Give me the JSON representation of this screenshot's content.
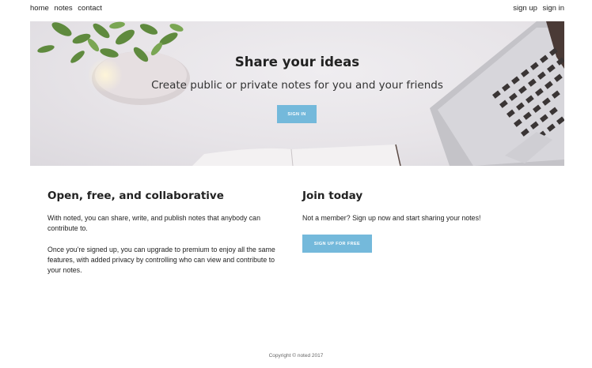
{
  "nav": {
    "left": [
      "home",
      "notes",
      "contact"
    ],
    "right": [
      "sign up",
      "sign in"
    ]
  },
  "hero": {
    "title": "Share your ideas",
    "subtitle": "Create public or private notes for you and your friends",
    "button_label": "SIGN IN"
  },
  "about": {
    "heading": "Open, free, and collaborative",
    "paragraph1": "With noted, you can share, write, and publish notes that anybody can contribute to.",
    "paragraph2": "Once you're signed up, you can upgrade to premium to enjoy all the same features, with added privacy by controlling who can view and contribute to your notes."
  },
  "join": {
    "heading": "Join today",
    "text": "Not a member? Sign up now and start sharing your notes!",
    "button_label": "SIGN UP FOR FREE"
  },
  "footer": {
    "copyright": "Copyright © noted 2017"
  },
  "colors": {
    "accent": "#74b9db",
    "hero_bg": "#e7e4e8"
  }
}
